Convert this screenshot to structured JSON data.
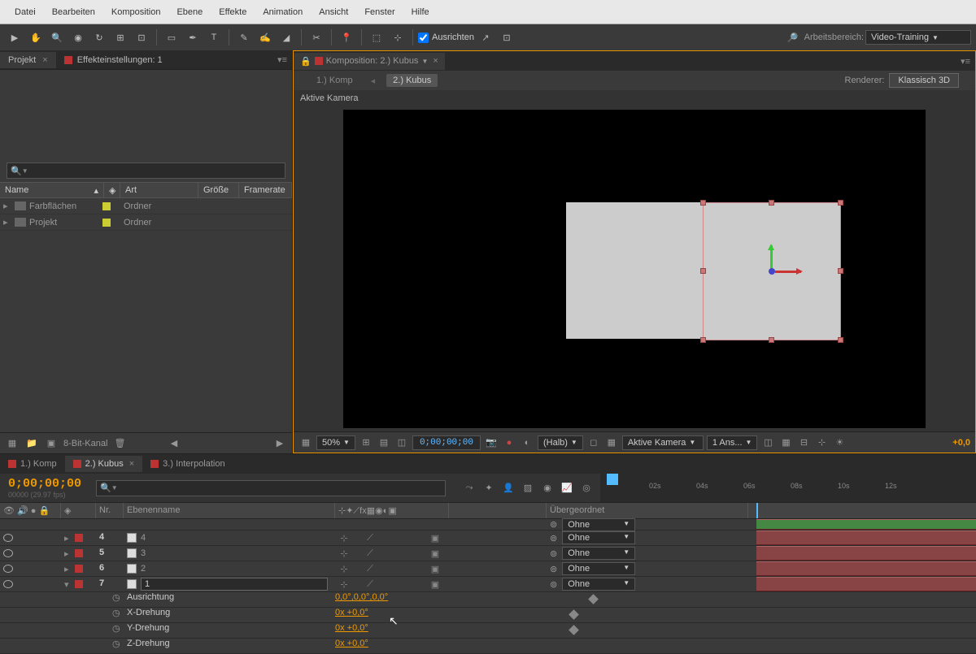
{
  "menu": {
    "items": [
      "Datei",
      "Bearbeiten",
      "Komposition",
      "Ebene",
      "Effekte",
      "Animation",
      "Ansicht",
      "Fenster",
      "Hilfe"
    ]
  },
  "toolbar": {
    "ausrichten": "Ausrichten",
    "arbeitsbereich": "Arbeitsbereich:",
    "workspace": "Video-Training"
  },
  "project": {
    "tab": "Projekt",
    "effectTab": "Effekteinstellungen: 1",
    "cols": {
      "name": "Name",
      "art": "Art",
      "groesse": "Größe",
      "framerate": "Framerate"
    },
    "rows": [
      {
        "name": "Farbflächen",
        "art": "Ordner"
      },
      {
        "name": "Projekt",
        "art": "Ordner"
      }
    ],
    "depth": "8-Bit-Kanal"
  },
  "comp": {
    "panelTitle": "Komposition: 2.) Kubus",
    "bc1": "1.) Komp",
    "bc2": "2.) Kubus",
    "rendererLabel": "Renderer:",
    "renderer": "Klassisch 3D",
    "camera": "Aktive Kamera",
    "zoom": "50%",
    "timecode": "0;00;00;00",
    "res": "(Halb)",
    "view": "Aktive Kamera",
    "views": "1 Ans...",
    "offset": "+0,0"
  },
  "timeline": {
    "tabs": [
      "1.) Komp",
      "2.) Kubus",
      "3.) Interpolation"
    ],
    "timecode": "0;00;00;00",
    "fps": "00000 (29.97 fps)",
    "cols": {
      "nr": "Nr.",
      "name": "Ebenenname",
      "parent": "Übergeordnet"
    },
    "ticks": [
      "02s",
      "04s",
      "06s",
      "08s",
      "10s",
      "12s"
    ],
    "layers": [
      {
        "nr": "4",
        "name": "4",
        "parent": "Ohne",
        "expanded": false,
        "selected": false
      },
      {
        "nr": "5",
        "name": "3",
        "parent": "Ohne",
        "expanded": false,
        "selected": false
      },
      {
        "nr": "6",
        "name": "2",
        "parent": "Ohne",
        "expanded": false,
        "selected": false
      },
      {
        "nr": "7",
        "name": "1",
        "parent": "Ohne",
        "expanded": true,
        "selected": true
      }
    ],
    "partialParent": "Ohne",
    "props": [
      {
        "name": "Ausrichtung",
        "value": "0,0°,0,0°,0,0°"
      },
      {
        "name": "X-Drehung",
        "value": "0x +0,0°"
      },
      {
        "name": "Y-Drehung",
        "value": "0x +0,0°"
      },
      {
        "name": "Z-Drehung",
        "value": "0x +0,0°"
      }
    ]
  }
}
